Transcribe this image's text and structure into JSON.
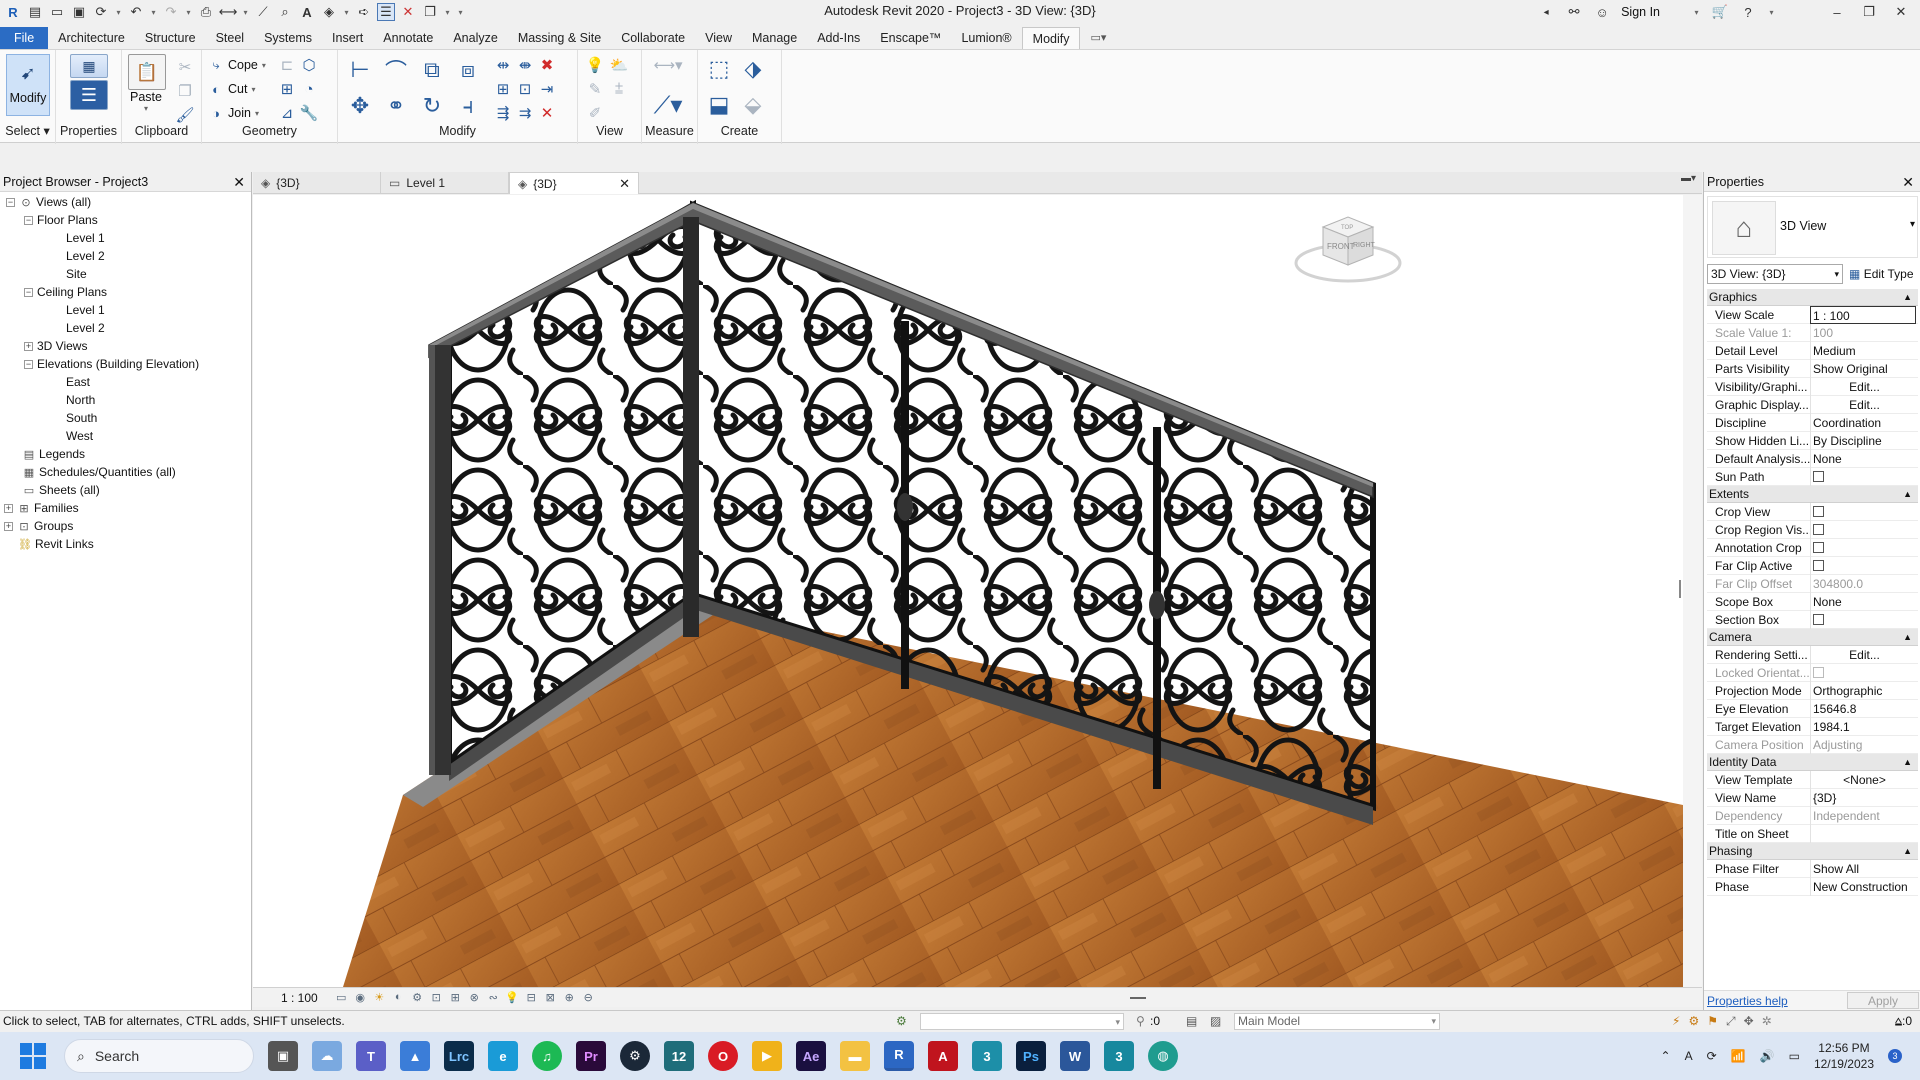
{
  "app_title": "Autodesk Revit 2020 - Project3 - 3D View: {3D}",
  "header_right": {
    "sign_in": "Sign In"
  },
  "ribbon_tabs": [
    {
      "label": "File"
    },
    {
      "label": "Architecture"
    },
    {
      "label": "Structure"
    },
    {
      "label": "Steel"
    },
    {
      "label": "Systems"
    },
    {
      "label": "Insert"
    },
    {
      "label": "Annotate"
    },
    {
      "label": "Analyze"
    },
    {
      "label": "Massing & Site"
    },
    {
      "label": "Collaborate"
    },
    {
      "label": "View"
    },
    {
      "label": "Manage"
    },
    {
      "label": "Add-Ins"
    },
    {
      "label": "Enscape™"
    },
    {
      "label": "Lumion®"
    },
    {
      "label": "Modify"
    }
  ],
  "ribbon": {
    "modify_btn": "Modify",
    "select_label": "Select",
    "properties_btn": "Properties",
    "paste_btn": "Paste",
    "clipboard_label": "Clipboard",
    "cope": "Cope",
    "cut": "Cut",
    "join": "Join",
    "geometry_label": "Geometry",
    "modify_label": "Modify",
    "view_label": "View",
    "measure_label": "Measure",
    "create_label": "Create"
  },
  "project_browser": {
    "title": "Project Browser - Project3",
    "items": [
      {
        "label": "Views (all)"
      },
      {
        "label": "Floor Plans"
      },
      {
        "label": "Level 1"
      },
      {
        "label": "Level 2"
      },
      {
        "label": "Site"
      },
      {
        "label": "Ceiling Plans"
      },
      {
        "label": "Level 1"
      },
      {
        "label": "Level 2"
      },
      {
        "label": "3D Views"
      },
      {
        "label": "Elevations (Building Elevation)"
      },
      {
        "label": "East"
      },
      {
        "label": "North"
      },
      {
        "label": "South"
      },
      {
        "label": "West"
      },
      {
        "label": "Legends"
      },
      {
        "label": "Schedules/Quantities (all)"
      },
      {
        "label": "Sheets (all)"
      },
      {
        "label": "Families"
      },
      {
        "label": "Groups"
      },
      {
        "label": "Revit Links"
      }
    ]
  },
  "view_tabs": [
    {
      "label": "{3D}"
    },
    {
      "label": "Level 1"
    },
    {
      "label": "{3D}"
    }
  ],
  "view_scale": "1 : 100",
  "properties": {
    "title": "Properties",
    "type_name": "3D View",
    "instance": "3D View: {3D}",
    "edit_type": "Edit Type",
    "groups": {
      "graphics": "Graphics",
      "extents": "Extents",
      "camera": "Camera",
      "identity": "Identity Data",
      "phasing": "Phasing"
    },
    "rows": {
      "view_scale": {
        "k": "View Scale",
        "v": "1 : 100"
      },
      "scale_value": {
        "k": "Scale Value    1:",
        "v": "100"
      },
      "detail_level": {
        "k": "Detail Level",
        "v": "Medium"
      },
      "parts_visibility": {
        "k": "Parts Visibility",
        "v": "Show Original"
      },
      "visibility_graphics": {
        "k": "Visibility/Graphi...",
        "v": "Edit..."
      },
      "graphic_display": {
        "k": "Graphic Display...",
        "v": "Edit..."
      },
      "discipline": {
        "k": "Discipline",
        "v": "Coordination"
      },
      "show_hidden": {
        "k": "Show Hidden Li...",
        "v": "By Discipline"
      },
      "default_analysis": {
        "k": "Default Analysis...",
        "v": "None"
      },
      "sun_path": {
        "k": "Sun Path"
      },
      "crop_view": {
        "k": "Crop View"
      },
      "crop_region": {
        "k": "Crop Region Vis..."
      },
      "annotation_crop": {
        "k": "Annotation Crop"
      },
      "far_clip_active": {
        "k": "Far Clip Active"
      },
      "far_clip_offset": {
        "k": "Far Clip Offset",
        "v": "304800.0"
      },
      "scope_box": {
        "k": "Scope Box",
        "v": "None"
      },
      "section_box": {
        "k": "Section Box"
      },
      "rendering": {
        "k": "Rendering Setti...",
        "v": "Edit..."
      },
      "locked_orient": {
        "k": "Locked Orientat..."
      },
      "projection_mode": {
        "k": "Projection Mode",
        "v": "Orthographic"
      },
      "eye_elevation": {
        "k": "Eye Elevation",
        "v": "15646.8"
      },
      "target_elevation": {
        "k": "Target Elevation",
        "v": "1984.1"
      },
      "camera_position": {
        "k": "Camera Position",
        "v": "Adjusting"
      },
      "view_template": {
        "k": "View Template",
        "v": "<None>"
      },
      "view_name": {
        "k": "View Name",
        "v": "{3D}"
      },
      "dependency": {
        "k": "Dependency",
        "v": "Independent"
      },
      "title_on_sheet": {
        "k": "Title on Sheet",
        "v": ""
      },
      "phase_filter": {
        "k": "Phase Filter",
        "v": "Show All"
      },
      "phase": {
        "k": "Phase",
        "v": "New Construction"
      }
    },
    "help_link": "Properties help",
    "apply": "Apply"
  },
  "viewcube": {
    "front": "FRONT",
    "right": "RIGHT",
    "top": "TOP"
  },
  "status_bar": {
    "message": "Click to select, TAB for alternates, CTRL adds, SHIFT unselects.",
    "selection_count": ":0",
    "model": "Main Model",
    "filter_count": ":0"
  },
  "taskbar": {
    "search": "Search",
    "time": "12:56 PM",
    "date": "12/19/2023",
    "notifications": "3",
    "apps": [
      "Lrc",
      "Ae",
      "Pr",
      "Ps",
      "R",
      "A"
    ]
  },
  "colors": {
    "file_tab": "#2b6cc4",
    "floor_wood": "#b86a2c",
    "railing": "#1c1c1c"
  }
}
